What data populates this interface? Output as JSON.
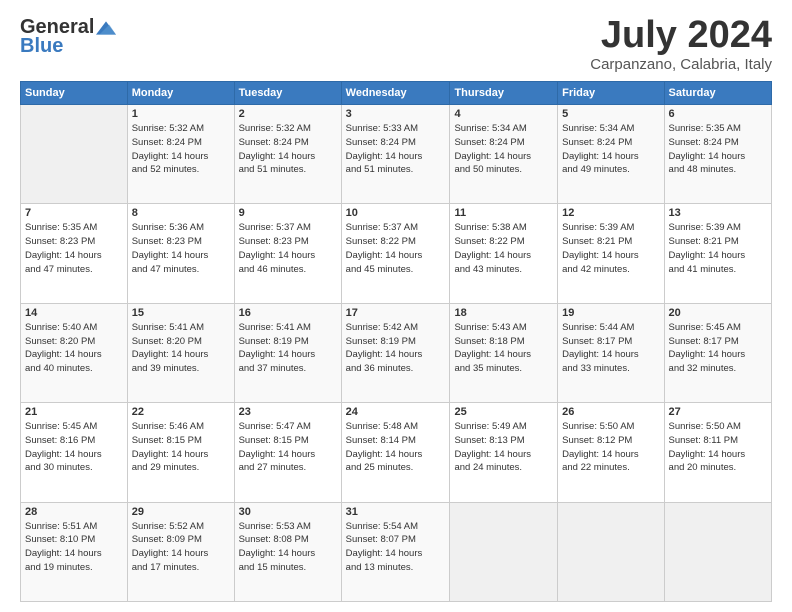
{
  "header": {
    "logo_general": "General",
    "logo_blue": "Blue",
    "month": "July 2024",
    "location": "Carpanzano, Calabria, Italy"
  },
  "days_of_week": [
    "Sunday",
    "Monday",
    "Tuesday",
    "Wednesday",
    "Thursday",
    "Friday",
    "Saturday"
  ],
  "weeks": [
    [
      {
        "day": "",
        "info": ""
      },
      {
        "day": "1",
        "info": "Sunrise: 5:32 AM\nSunset: 8:24 PM\nDaylight: 14 hours\nand 52 minutes."
      },
      {
        "day": "2",
        "info": "Sunrise: 5:32 AM\nSunset: 8:24 PM\nDaylight: 14 hours\nand 51 minutes."
      },
      {
        "day": "3",
        "info": "Sunrise: 5:33 AM\nSunset: 8:24 PM\nDaylight: 14 hours\nand 51 minutes."
      },
      {
        "day": "4",
        "info": "Sunrise: 5:34 AM\nSunset: 8:24 PM\nDaylight: 14 hours\nand 50 minutes."
      },
      {
        "day": "5",
        "info": "Sunrise: 5:34 AM\nSunset: 8:24 PM\nDaylight: 14 hours\nand 49 minutes."
      },
      {
        "day": "6",
        "info": "Sunrise: 5:35 AM\nSunset: 8:24 PM\nDaylight: 14 hours\nand 48 minutes."
      }
    ],
    [
      {
        "day": "7",
        "info": "Sunrise: 5:35 AM\nSunset: 8:23 PM\nDaylight: 14 hours\nand 47 minutes."
      },
      {
        "day": "8",
        "info": "Sunrise: 5:36 AM\nSunset: 8:23 PM\nDaylight: 14 hours\nand 47 minutes."
      },
      {
        "day": "9",
        "info": "Sunrise: 5:37 AM\nSunset: 8:23 PM\nDaylight: 14 hours\nand 46 minutes."
      },
      {
        "day": "10",
        "info": "Sunrise: 5:37 AM\nSunset: 8:22 PM\nDaylight: 14 hours\nand 45 minutes."
      },
      {
        "day": "11",
        "info": "Sunrise: 5:38 AM\nSunset: 8:22 PM\nDaylight: 14 hours\nand 43 minutes."
      },
      {
        "day": "12",
        "info": "Sunrise: 5:39 AM\nSunset: 8:21 PM\nDaylight: 14 hours\nand 42 minutes."
      },
      {
        "day": "13",
        "info": "Sunrise: 5:39 AM\nSunset: 8:21 PM\nDaylight: 14 hours\nand 41 minutes."
      }
    ],
    [
      {
        "day": "14",
        "info": "Sunrise: 5:40 AM\nSunset: 8:20 PM\nDaylight: 14 hours\nand 40 minutes."
      },
      {
        "day": "15",
        "info": "Sunrise: 5:41 AM\nSunset: 8:20 PM\nDaylight: 14 hours\nand 39 minutes."
      },
      {
        "day": "16",
        "info": "Sunrise: 5:41 AM\nSunset: 8:19 PM\nDaylight: 14 hours\nand 37 minutes."
      },
      {
        "day": "17",
        "info": "Sunrise: 5:42 AM\nSunset: 8:19 PM\nDaylight: 14 hours\nand 36 minutes."
      },
      {
        "day": "18",
        "info": "Sunrise: 5:43 AM\nSunset: 8:18 PM\nDaylight: 14 hours\nand 35 minutes."
      },
      {
        "day": "19",
        "info": "Sunrise: 5:44 AM\nSunset: 8:17 PM\nDaylight: 14 hours\nand 33 minutes."
      },
      {
        "day": "20",
        "info": "Sunrise: 5:45 AM\nSunset: 8:17 PM\nDaylight: 14 hours\nand 32 minutes."
      }
    ],
    [
      {
        "day": "21",
        "info": "Sunrise: 5:45 AM\nSunset: 8:16 PM\nDaylight: 14 hours\nand 30 minutes."
      },
      {
        "day": "22",
        "info": "Sunrise: 5:46 AM\nSunset: 8:15 PM\nDaylight: 14 hours\nand 29 minutes."
      },
      {
        "day": "23",
        "info": "Sunrise: 5:47 AM\nSunset: 8:15 PM\nDaylight: 14 hours\nand 27 minutes."
      },
      {
        "day": "24",
        "info": "Sunrise: 5:48 AM\nSunset: 8:14 PM\nDaylight: 14 hours\nand 25 minutes."
      },
      {
        "day": "25",
        "info": "Sunrise: 5:49 AM\nSunset: 8:13 PM\nDaylight: 14 hours\nand 24 minutes."
      },
      {
        "day": "26",
        "info": "Sunrise: 5:50 AM\nSunset: 8:12 PM\nDaylight: 14 hours\nand 22 minutes."
      },
      {
        "day": "27",
        "info": "Sunrise: 5:50 AM\nSunset: 8:11 PM\nDaylight: 14 hours\nand 20 minutes."
      }
    ],
    [
      {
        "day": "28",
        "info": "Sunrise: 5:51 AM\nSunset: 8:10 PM\nDaylight: 14 hours\nand 19 minutes."
      },
      {
        "day": "29",
        "info": "Sunrise: 5:52 AM\nSunset: 8:09 PM\nDaylight: 14 hours\nand 17 minutes."
      },
      {
        "day": "30",
        "info": "Sunrise: 5:53 AM\nSunset: 8:08 PM\nDaylight: 14 hours\nand 15 minutes."
      },
      {
        "day": "31",
        "info": "Sunrise: 5:54 AM\nSunset: 8:07 PM\nDaylight: 14 hours\nand 13 minutes."
      },
      {
        "day": "",
        "info": ""
      },
      {
        "day": "",
        "info": ""
      },
      {
        "day": "",
        "info": ""
      }
    ]
  ]
}
